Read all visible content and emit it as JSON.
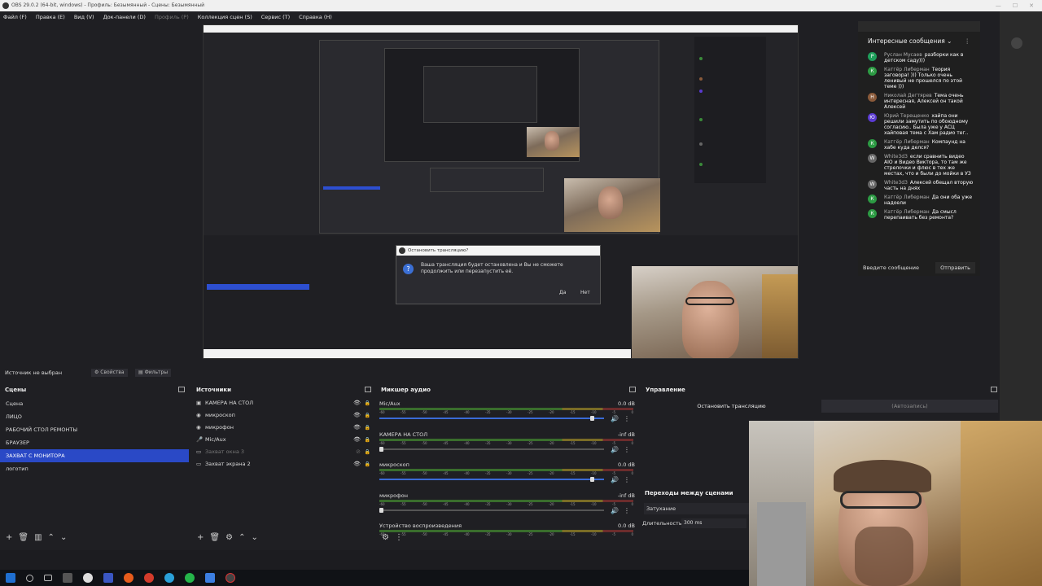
{
  "window": {
    "title": "OBS 29.0.2 (64-bit, windows) - Профиль: Безымянный - Сцены: Безымянный"
  },
  "menu": [
    {
      "label": "Файл (F)",
      "disabled": false
    },
    {
      "label": "Правка (E)",
      "disabled": false
    },
    {
      "label": "Вид (V)",
      "disabled": false
    },
    {
      "label": "Док-панели (D)",
      "disabled": false
    },
    {
      "label": "Профиль (P)",
      "disabled": true
    },
    {
      "label": "Коллекция сцен (S)",
      "disabled": false
    },
    {
      "label": "Сервис (T)",
      "disabled": false
    },
    {
      "label": "Справка (H)",
      "disabled": false
    }
  ],
  "preview": {
    "dialog": {
      "title": "Остановить трансляцию?",
      "message": "Ваша трансляция будет остановлена и Вы не сможете продолжить или перезапустить её.",
      "yes": "Да",
      "no": "Нет"
    }
  },
  "sourcebar": {
    "no_source": "Источник не выбран",
    "properties": "Свойства",
    "filters": "Фильтры"
  },
  "scenes": {
    "title": "Сцены",
    "items": [
      "Сцена",
      "ЛИЦО",
      "РАБОЧИЙ СТОЛ РЕМОНТЫ",
      "БРАУЗЕР",
      "ЗАХВАТ С МОНИТОРА",
      "логотип"
    ],
    "selected_index": 4
  },
  "sources": {
    "title": "Источники",
    "items": [
      {
        "label": "КАМЕРА НА СТОЛ",
        "icon": "camera-icon",
        "visible": true
      },
      {
        "label": "микроскоп",
        "icon": "camera-icon",
        "visible": true
      },
      {
        "label": "микрофон",
        "icon": "mic-icon",
        "visible": true
      },
      {
        "label": "Mic/Aux",
        "icon": "mic-icon",
        "visible": true
      },
      {
        "label": "Захват окна 3",
        "icon": "window-icon",
        "visible": false
      },
      {
        "label": "Захват экрана 2",
        "icon": "monitor-icon",
        "visible": true
      }
    ]
  },
  "mixer": {
    "title": "Микшер аудио",
    "ticks": [
      "-60",
      "-55",
      "-50",
      "-45",
      "-40",
      "-35",
      "-30",
      "-25",
      "-20",
      "-15",
      "-10",
      "-5",
      "0"
    ],
    "channels": [
      {
        "name": "Mic/Aux",
        "db": "0.0 dB",
        "level": 0.95
      },
      {
        "name": "КАМЕРА НА СТОЛ",
        "db": "-inf dB",
        "level": 0
      },
      {
        "name": "микроскоп",
        "db": "0.0 dB",
        "level": 0.95
      },
      {
        "name": "микрофон",
        "db": "-inf dB",
        "level": 0
      },
      {
        "name": "Устройство воспроизведения",
        "db": "0.0 dB",
        "level": 0.95
      }
    ]
  },
  "controls": {
    "title": "Управление",
    "stop_stream": "Остановить трансляцию",
    "auto_record": "(Автозапись)"
  },
  "transitions": {
    "title": "Переходы между сценами",
    "type": "Затухание",
    "duration_label": "Длительность",
    "duration_value": "300 ms"
  },
  "chat": {
    "header": "Интересные сообщения",
    "messages": [
      {
        "author": "Руслан Мусаев",
        "text": "разборки как в детском саду)))",
        "avatar": "Р",
        "color": "#1e9e5a"
      },
      {
        "author": "Катгёр Либерман",
        "text": "Теория заговора! ))) Только очень ленивый не прошелся по этой теме )))",
        "avatar": "К",
        "color": "#2c9a43"
      },
      {
        "author": "Николай Дегтярев",
        "text": "Тема очень интересная, Алексей он такой Алексей",
        "avatar": "Н",
        "color": "#8a5a3a"
      },
      {
        "author": "Юрий Терещенко",
        "text": "хайпа они решили замутить по обоюдному согласию.. Была уже у АСЦ хайповая тема с Хам радио тег..",
        "avatar": "Ю",
        "color": "#5a3ad1"
      },
      {
        "author": "Катгёр Либерман",
        "text": "Компаунд на хабе куда делся?",
        "avatar": "К",
        "color": "#2c9a43"
      },
      {
        "author": "White3d3",
        "text": "если сравнить видео AIO и Видео Виктора, то там же стрелочки и флюс в тех же местах, что и были до мойки в УЗ",
        "avatar": "W",
        "color": "#666"
      },
      {
        "author": "White3d3",
        "text": "Алексей обещал вторую часть на днях",
        "avatar": "W",
        "color": "#666"
      },
      {
        "author": "Катгёр Либерман",
        "text": "Да они оба уже надоели",
        "avatar": "К",
        "color": "#2c9a43"
      },
      {
        "author": "Катгёр Либерман",
        "text": "Да смысл перепаивать без ремонта?",
        "avatar": "К",
        "color": "#2c9a43"
      }
    ],
    "input_placeholder": "Введите сообщение",
    "send": "Отправить"
  }
}
